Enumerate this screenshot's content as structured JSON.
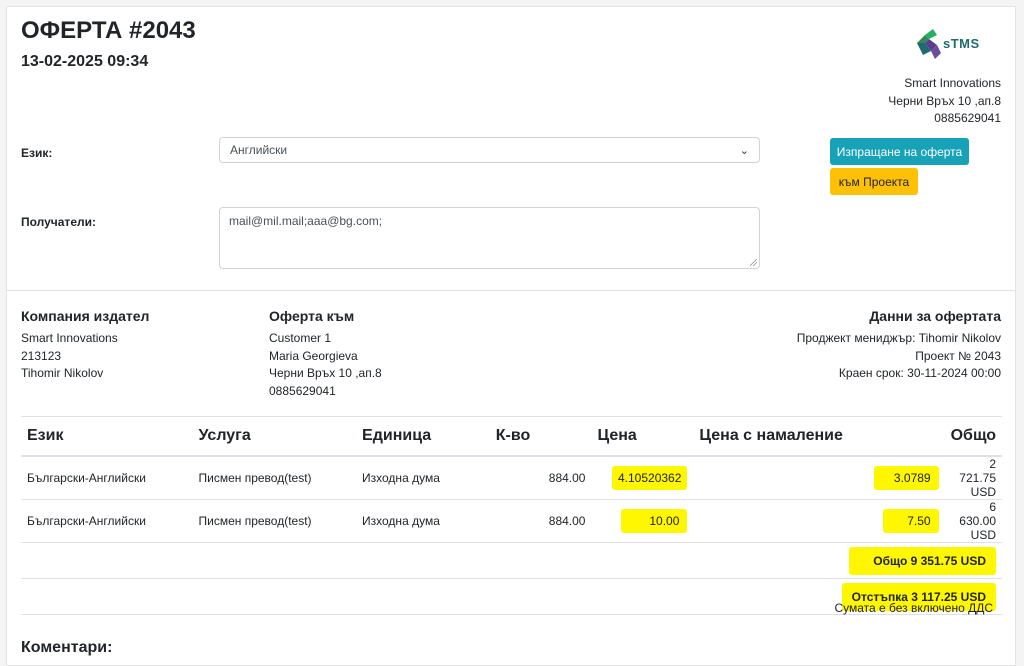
{
  "offer": {
    "title": "ОФЕРТА #2043",
    "datetime": "13-02-2025 09:34"
  },
  "logo": {
    "text": "sTMS",
    "icon": "puzzle-logo-icon"
  },
  "issuer_top": {
    "name": "Smart Innovations",
    "address": "Черни Връх 10 ,ап.8",
    "phone": "0885629041"
  },
  "form": {
    "language_label": "Език:",
    "language_value": "Английски",
    "recipients_label": "Получатели:",
    "recipients_value": "mail@mil.mail;aaa@bg.com;",
    "send_button": "Изпращане на оферта",
    "project_button": "към Проекта"
  },
  "issuer": {
    "heading": "Компания издател",
    "name": "Smart Innovations",
    "id": "213123",
    "person": "Tihomir Nikolov"
  },
  "recipient": {
    "heading": "Оферта към",
    "customer": "Customer 1",
    "person": "Maria Georgieva",
    "address": "Черни Връх 10 ,ап.8",
    "phone": "0885629041"
  },
  "offer_data": {
    "heading": "Данни за офертата",
    "manager": "Проджект мениджър: Tihomir Nikolov",
    "project": "Проект № 2043",
    "deadline": "Краен срок: 30-11-2024 00:00"
  },
  "table": {
    "headers": [
      "Език",
      "Услуга",
      "Единица",
      "К-во",
      "Цена",
      "Цена с намаление",
      "Общо"
    ],
    "rows": [
      [
        "Български-Английски",
        "Писмен превод(test)",
        "Изходна дума",
        "884.00",
        "4.10520362",
        "3.0789",
        "2 721.75 USD"
      ],
      [
        "Български-Английски",
        "Писмен превод(test)",
        "Изходна дума",
        "884.00",
        "10.00",
        "7.50",
        "6 630.00 USD"
      ]
    ],
    "total": "Общо  9 351.75 USD",
    "discount": "Отстъпка  3 117.25 USD",
    "vat_note": "Сумата е без включено ДДС"
  },
  "comments_heading": "Коментари:",
  "colors": {
    "send": "#17a2b8",
    "project": "#ffc107",
    "highlight": "#fff700"
  }
}
